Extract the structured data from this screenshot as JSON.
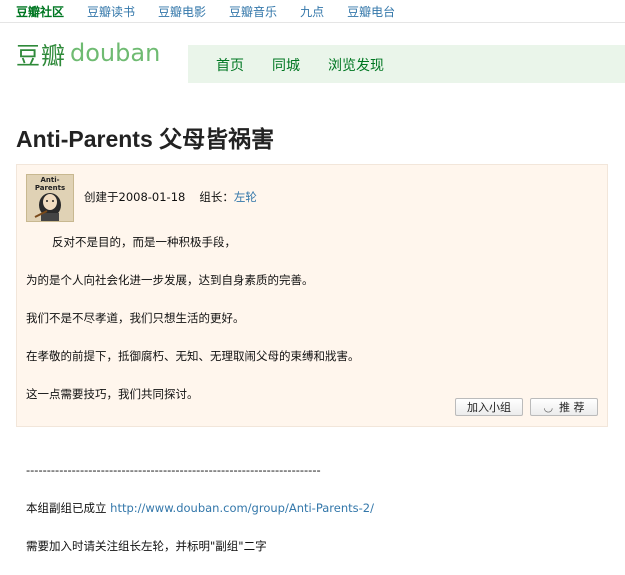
{
  "topnav": {
    "items": [
      "豆瓣社区",
      "豆瓣读书",
      "豆瓣电影",
      "豆瓣音乐",
      "九点",
      "豆瓣电台"
    ]
  },
  "logo": {
    "cn": "豆瓣",
    "en": "douban"
  },
  "mainnav": {
    "items": [
      "首页",
      "同城",
      "浏览发现"
    ]
  },
  "title": "Anti-Parents 父母皆祸害",
  "avatar": {
    "caption": "Anti-Parents",
    "icon": "avatar-icon"
  },
  "meta": {
    "created": "创建于2008-01-18",
    "leader_label": "组长：",
    "leader_name": "左轮"
  },
  "description": {
    "lines": [
      "反对不是目的，而是一种积极手段，",
      "为的是个人向社会化进一步发展，达到自身素质的完善。",
      "我们不是不尽孝道，我们只想生活的更好。",
      "在孝敬的前提下，抵御腐朽、无知、无理取闹父母的束缚和戕害。",
      "这一点需要技巧，我们共同探讨。",
      "",
      "-----------------------------------------------------------------------",
      "本组副组已成立 ",
      "需要加入时请关注组长左轮，并标明\"副组\"二字"
    ],
    "link": "http://www.douban.com/group/Anti-Parents-2/"
  },
  "buttons": {
    "join": "加入小组",
    "recommend": "推 荐",
    "recommend_icon": "smile-icon"
  },
  "colors": {
    "link": "#3377aa",
    "brand_green": "#007722",
    "panel_bg": "#fff6ed"
  }
}
